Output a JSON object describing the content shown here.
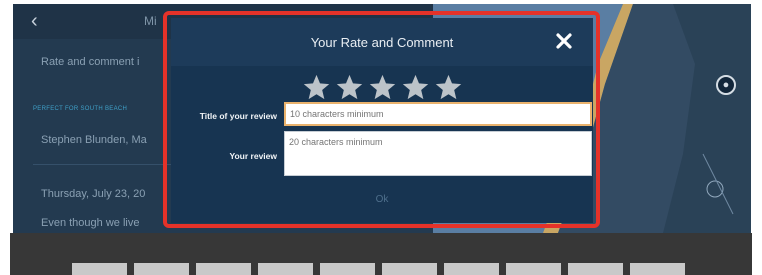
{
  "background_app": {
    "header_title": "Mi",
    "prompt": "Rate and comment i",
    "section_label": "PERFECT FOR SOUTH BEACH",
    "author": "Stephen Blunden, Ma",
    "date": "Thursday, July 23, 20",
    "body": "Even though we live"
  },
  "dialog": {
    "title": "Your Rate and Comment",
    "close_icon": "close-icon",
    "rating": 5,
    "stars": [
      "star-icon",
      "star-icon",
      "star-icon",
      "star-icon",
      "star-icon"
    ],
    "title_label": "Title of your review",
    "title_placeholder": "10 characters minimum",
    "review_label": "Your review",
    "review_placeholder": "20 characters minimum",
    "ok_label": "Ok"
  },
  "map": {
    "compass_icon": "compass-icon"
  },
  "colors": {
    "highlight": "#e53229",
    "dialog_bg": "#173451",
    "title_field_border": "#e9b26d",
    "star": "#bcc3c9"
  }
}
